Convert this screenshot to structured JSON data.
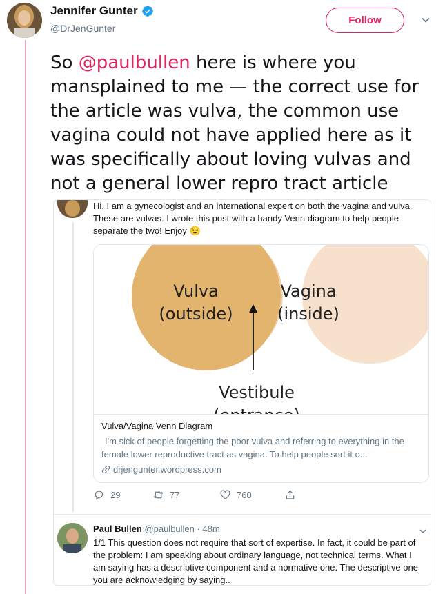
{
  "author": {
    "name": "Jennifer Gunter",
    "handle": "@DrJenGunter"
  },
  "follow_label": "Follow",
  "tweet": {
    "prefix": "So ",
    "mention": "@paulbullen",
    "body": " here is where you mansplained to me — the correct use for the article was vulva, the common use vagina could not have applied here as it was specifically about loving vulvas and not a general lower repro tract article"
  },
  "quoted": {
    "text": "Hi, I am a gynecologist and an international expert on both the vagina and vulva. These are vulvas. I wrote this post with a handy Venn diagram to help people separate the two! Enjoy",
    "emoji": "😉",
    "card": {
      "image": {
        "left_label_1": "Vulva",
        "left_label_2": "(outside)",
        "right_label_1": "Vagina",
        "right_label_2": "(inside)",
        "bottom_label_1": "Vestibule",
        "bottom_label_2": "(entrance)"
      },
      "title": "Vulva/Vagina Venn Diagram",
      "description": "I'm sick of people forgetting the poor vulva and referring to everything in the female lower reproductive tract as vagina. To help people sort it o...",
      "link": "drjengunter.wordpress.com"
    },
    "actions": {
      "replies": "29",
      "retweets": "77",
      "likes": "760"
    }
  },
  "reply": {
    "name": "Paul Bullen",
    "handle": "@paulbullen",
    "separator": " · ",
    "time": "48m",
    "text": "1/1 This question does not require that sort of expertise. In fact, it could be part of the problem: I am speaking about ordinary language, not technical terms. What I am saying has a descriptive component and a normative one. The descriptive one you are acknowledging by saying.."
  },
  "colors": {
    "accent": "#e0245e",
    "thread_line": "#e6a6bc",
    "vulva_circle": "#e2b46e",
    "vagina_circle": "#f7e1cc",
    "muted_text": "#657786",
    "verified": "#1da1f2"
  },
  "icons": [
    "verified-badge-icon",
    "chevron-down-icon",
    "reply-icon",
    "retweet-icon",
    "like-icon",
    "share-icon",
    "link-icon"
  ]
}
